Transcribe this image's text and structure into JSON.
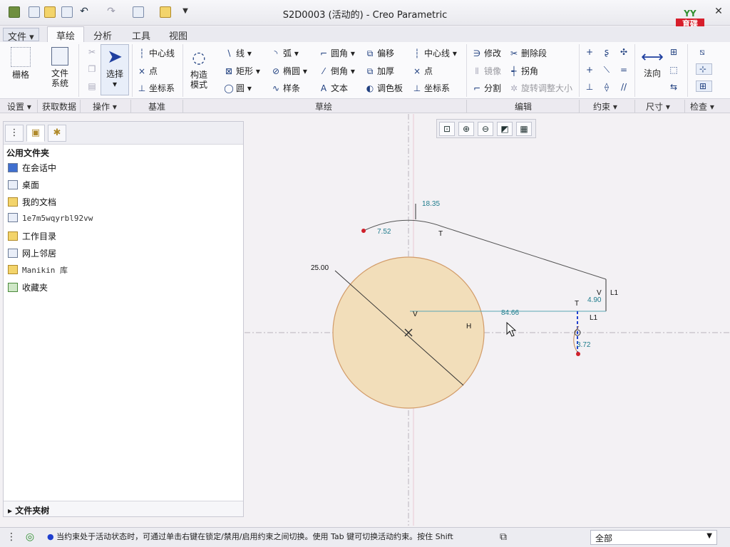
{
  "window": {
    "title": "S2D0003 (活动的) - Creo Parametric"
  },
  "logo": {
    "top": "YY",
    "line1": "育碟",
    "line2": "软件"
  },
  "menu": {
    "file": "文件",
    "tabs": [
      "草绘",
      "分析",
      "工具",
      "视图"
    ]
  },
  "ribbon": {
    "grid": "栅格",
    "filesystem_l1": "文件",
    "filesystem_l2": "系统",
    "select": "选择",
    "centerline": "中心线",
    "point": "点",
    "csys": "坐标系",
    "construct_l1": "构造",
    "construct_l2": "模式",
    "line": "线",
    "rect": "矩形",
    "circle": "圆",
    "arc": "弧",
    "ellipse": "椭圆",
    "spline": "样条",
    "fillet": "圆角",
    "chamfer": "倒角",
    "text": "文本",
    "offset": "偏移",
    "thicken": "加厚",
    "palette": "调色板",
    "centerline2": "中心线",
    "point2": "点",
    "csys2": "坐标系",
    "modify": "修改",
    "delete_seg": "删除段",
    "mirror": "镜像",
    "corner": "拐角",
    "divide": "分割",
    "rotate_resize": "旋转调整大小",
    "normal": "法向"
  },
  "groups": {
    "setup": "设置",
    "getdata": "获取数据",
    "ops": "操作",
    "datum": "基准",
    "sketch": "草绘",
    "edit": "编辑",
    "constrain": "约束",
    "dimension": "尺寸",
    "inspect": "检查"
  },
  "panel": {
    "header": "公用文件夹",
    "items": [
      "在会话中",
      "桌面",
      "我的文档",
      "1e7m5wqyrbl92vw",
      "工作目录",
      "网上邻居",
      "Manikin 库",
      "收藏夹"
    ],
    "tree": "文件夹树"
  },
  "sketch": {
    "dims": {
      "r": "25.00",
      "d1": "18.35",
      "d2": "7.52",
      "d3": "4.90",
      "d4": "84.66",
      "d5": "3.72"
    },
    "labels": {
      "H": "H",
      "V": "V",
      "T": "T",
      "L1": "L1"
    }
  },
  "status": {
    "message": "当约束处于活动状态时，可通过单击右键在锁定/禁用/启用约束之间切换。使用 Tab 键可切换活动约束。按住 Shift",
    "filter": "全部"
  }
}
